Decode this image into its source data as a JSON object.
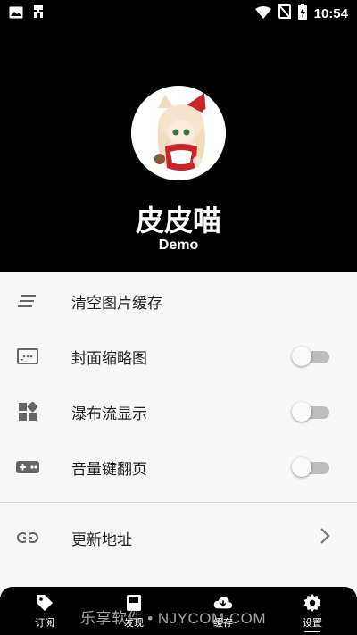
{
  "status_bar": {
    "time": "10:54",
    "icons": [
      "image-icon",
      "bug-icon",
      "wifi-icon",
      "no-sim-icon",
      "battery-charging-icon"
    ]
  },
  "profile": {
    "name": "皮皮喵",
    "subtitle": "Demo",
    "avatar_icon": "anime-avatar"
  },
  "settings": {
    "items": [
      {
        "label": "清空图片缓存",
        "icon": "clear-list-icon"
      },
      {
        "label": "封面缩略图",
        "icon": "thumbnail-icon",
        "toggle": false
      },
      {
        "label": "瀑布流显示",
        "icon": "waterfall-grid-icon",
        "toggle": false
      },
      {
        "label": "音量键翻页",
        "icon": "gamepad-icon",
        "toggle": false
      },
      {
        "label": "更新地址",
        "icon": "link-icon"
      }
    ]
  },
  "bottom_nav": {
    "items": [
      {
        "label": "订阅",
        "icon": "tag-icon",
        "active": false
      },
      {
        "label": "发现",
        "icon": "discover-icon",
        "active": false
      },
      {
        "label": "缓存",
        "icon": "cloud-download-icon",
        "active": false
      },
      {
        "label": "设置",
        "icon": "gear-icon",
        "active": true
      }
    ]
  },
  "watermark": "乐享软件 • NJYCOM.COM",
  "colors": {
    "header_bg": "#000000",
    "content_bg": "#f7f7f7",
    "toggle_off": "#bdbdbd"
  }
}
